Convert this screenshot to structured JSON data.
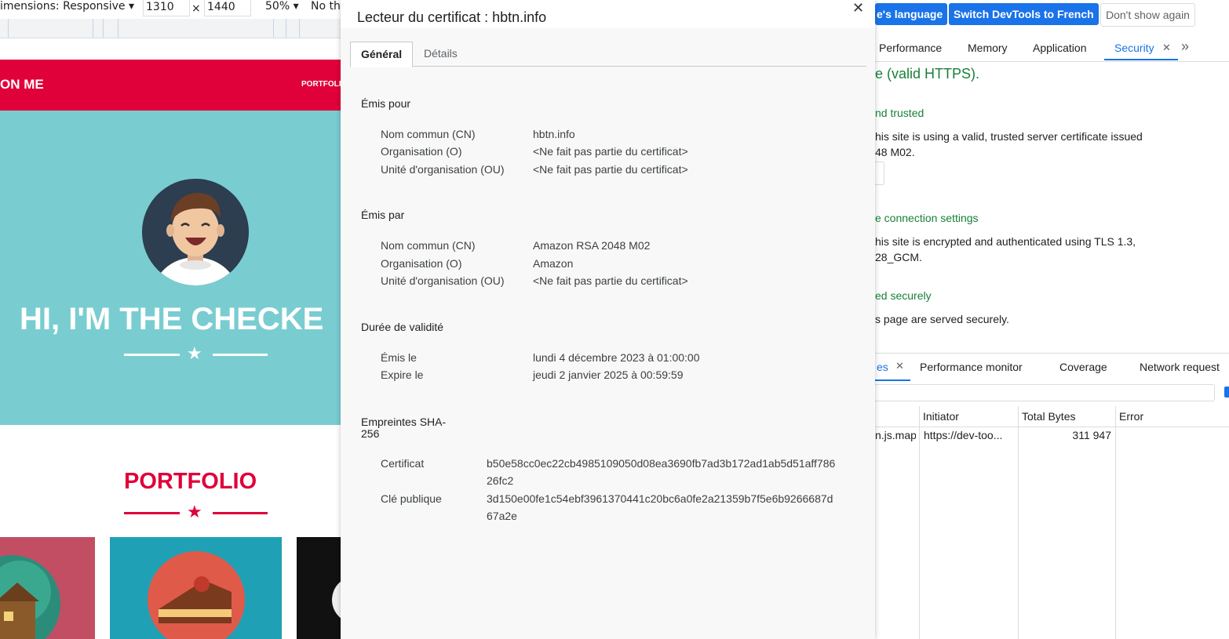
{
  "device_toolbar": {
    "dimensions_label": "imensions: Responsive ▾",
    "width": "1310",
    "times": "×",
    "height": "1440",
    "zoom": "50% ▾",
    "throttle": "No th"
  },
  "site": {
    "logo": "ON ME",
    "nav_portfolio": "PORTFOLI",
    "hero_title": "HI, I'M THE CHECKE",
    "portfolio_title": "PORTFOLIO",
    "star": "★"
  },
  "devtools": {
    "lang_button": "e's language",
    "switch_button": "Switch DevTools to French",
    "dont_show": "Don't show again",
    "tabs": [
      "Performance",
      "Memory",
      "Application",
      "Security"
    ],
    "close_x": "✕",
    "more": "»",
    "security": {
      "summary": "e (valid HTTPS).",
      "cert_heading": "nd trusted",
      "cert_text_1": "his site is using a valid, trusted server certificate issued",
      "cert_text_2": "48 M02.",
      "conn_heading": "e connection settings",
      "conn_text_1": "his site is encrypted and authenticated using TLS 1.3,",
      "conn_text_2": "28_GCM.",
      "res_heading": "ed securely",
      "res_text": "s page are served securely."
    },
    "drawer_tabs": [
      "es",
      "Performance monitor",
      "Coverage",
      "Network request"
    ],
    "table": {
      "headers": [
        "",
        "Initiator",
        "Total Bytes",
        "Error"
      ],
      "row": [
        "n.js.map",
        "https://dev-too...",
        "311 947",
        ""
      ]
    }
  },
  "certificate": {
    "title": "Lecteur du certificat : hbtn.info",
    "close": "✕",
    "tabs": {
      "general": "Général",
      "details": "Détails"
    },
    "issued_to": {
      "heading": "Émis pour",
      "cn_label": "Nom commun (CN)",
      "cn_value": "hbtn.info",
      "o_label": "Organisation (O)",
      "o_value": "<Ne fait pas partie du certificat>",
      "ou_label": "Unité d'organisation (OU)",
      "ou_value": "<Ne fait pas partie du certificat>"
    },
    "issued_by": {
      "heading": "Émis par",
      "cn_label": "Nom commun (CN)",
      "cn_value": "Amazon RSA 2048 M02",
      "o_label": "Organisation (O)",
      "o_value": "Amazon",
      "ou_label": "Unité d'organisation (OU)",
      "ou_value": "<Ne fait pas partie du certificat>"
    },
    "validity": {
      "heading": "Durée de validité",
      "issued_label": "Émis le",
      "issued_value": "lundi 4 décembre 2023 à 01:00:00",
      "expires_label": "Expire le",
      "expires_value": "jeudi 2 janvier 2025 à 00:59:59"
    },
    "fingerprints": {
      "heading_1": "Empreintes SHA-",
      "heading_2": "256",
      "cert_label": "Certificat",
      "cert_value_1": "b50e58cc0ec22cb4985109050d08ea3690fb7ad3b172ad1ab5d51aff786",
      "cert_value_2": "26fc2",
      "key_label": "Clé publique",
      "key_value_1": "3d150e00fe1c54ebf3961370441c20bc6a0fe2a21359b7f5e6b9266687d",
      "key_value_2": "67a2e"
    }
  }
}
